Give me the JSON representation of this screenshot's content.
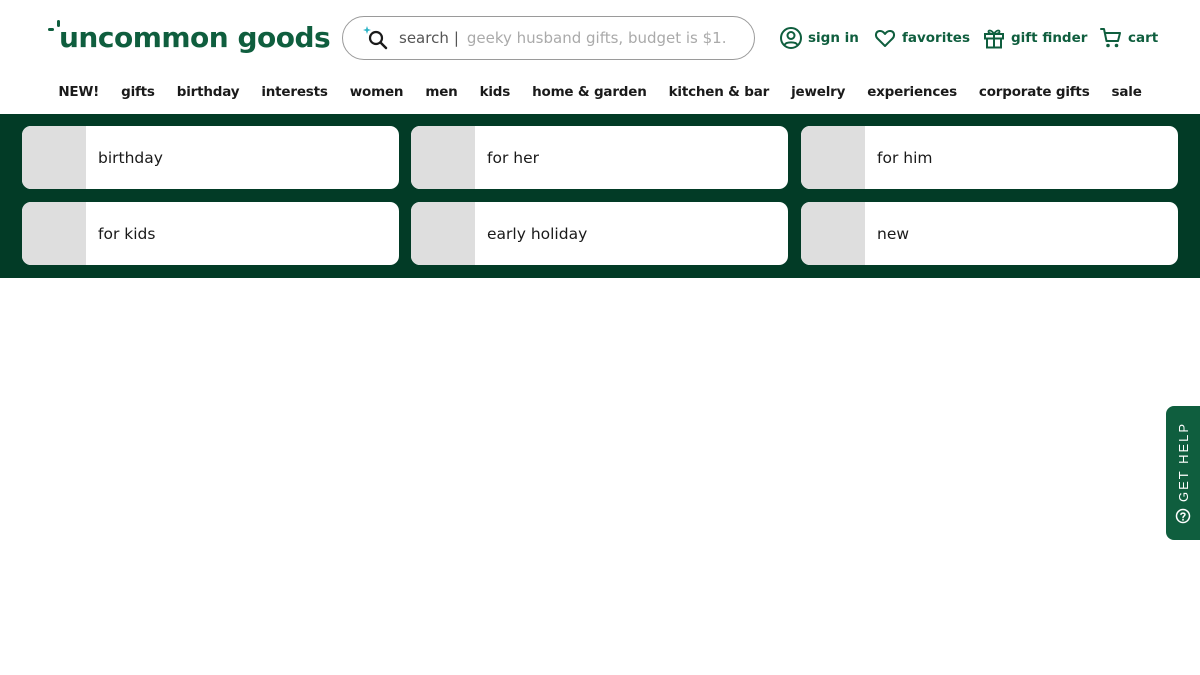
{
  "logo": {
    "text": "uncommon goods"
  },
  "search": {
    "label": "search",
    "separator": "|",
    "placeholder": "geeky husband gifts, budget is $1..."
  },
  "utility": {
    "signin": "sign in",
    "favorites": "favorites",
    "gift_finder": "gift finder",
    "cart": "cart"
  },
  "nav": [
    "NEW!",
    "gifts",
    "birthday",
    "interests",
    "women",
    "men",
    "kids",
    "home & garden",
    "kitchen & bar",
    "jewelry",
    "experiences",
    "corporate gifts",
    "sale"
  ],
  "categories": [
    "birthday",
    "for her",
    "for him",
    "for kids",
    "early holiday",
    "new"
  ],
  "help": {
    "label": "GET HELP"
  },
  "colors": {
    "brand": "#0f5e3e",
    "band": "#023b26",
    "accent": "#2cb3c6"
  }
}
